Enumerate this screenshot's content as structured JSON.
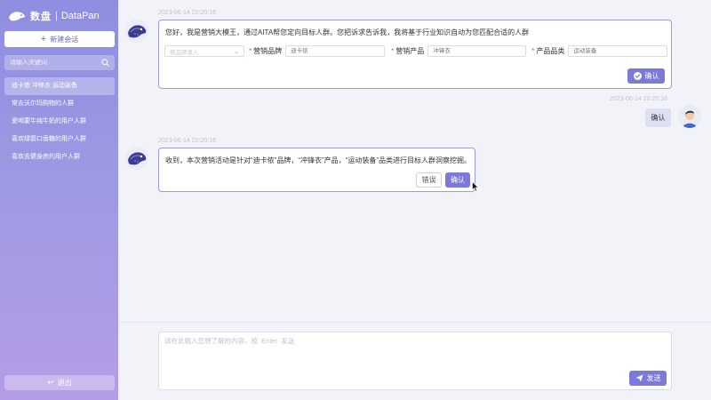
{
  "brand": {
    "name": "数盘",
    "separator": "|",
    "name_en": "DataPan"
  },
  "sidebar": {
    "new_chat_label": "新建会话",
    "search_placeholder": "请输入关键词",
    "history": [
      {
        "label": "迪卡侬 冲锋衣 运动装备",
        "active": true
      },
      {
        "label": "常去沃尔玛购物的人群",
        "active": false
      },
      {
        "label": "爱喝蒙牛纯牛奶的用户人群",
        "active": false
      },
      {
        "label": "喜欢绿箭口香糖的用户人群",
        "active": false
      },
      {
        "label": "喜欢去健身房的用户人群",
        "active": false
      }
    ],
    "logout_label": "退出"
  },
  "messages": {
    "m1": {
      "timestamp": "2023-06-14 20:20:16",
      "text": "您好，我是营销大模王，通过AITA帮您定向目标人群。您把诉求告诉我，我将基于行业知识自动为您匹配合适的人群",
      "form": {
        "select_placeholder": "按品牌录入",
        "brand_label": "营销品牌",
        "brand_value": "迪卡侬",
        "product_label": "营销产品",
        "product_value": "冲锋衣",
        "category_label": "产品品类",
        "category_value": "运动装备",
        "required_mark": "*"
      },
      "confirm_label": "确认"
    },
    "user_reply": {
      "timestamp": "2023-06-14 20:20:16",
      "text": "确认"
    },
    "m2": {
      "timestamp": "2023-06-14 20:20:16",
      "text": "收到，本次营销活动是针对“迪卡侬”品牌，“冲锋衣”产品，“运动装备”品类进行目标人群洞察挖掘。",
      "error_label": "错误",
      "confirm_label": "确认"
    }
  },
  "composer": {
    "placeholder": "请在此输入您想了解的内容，按  Enter  发送",
    "send_label": "发送"
  },
  "colors": {
    "accent": "#7b79d9",
    "sidebar_top": "#8e8de0",
    "sidebar_bottom": "#b59ce6",
    "bubble_border": "#9b9ae3"
  }
}
